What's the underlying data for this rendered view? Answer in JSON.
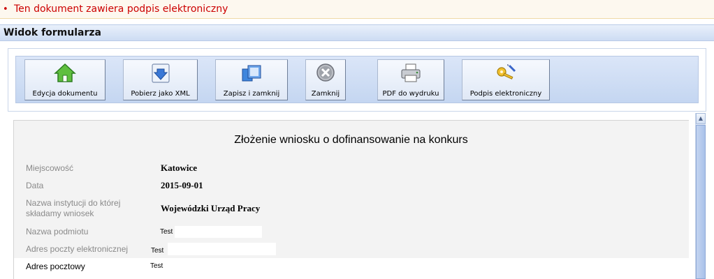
{
  "notice": {
    "bullet": "•",
    "text": "Ten dokument zawiera podpis elektroniczny",
    "color": "#cc0000"
  },
  "header": {
    "title": "Widok formularza"
  },
  "toolbar": {
    "buttons": [
      {
        "label": "Edycja dokumentu",
        "icon": "home-icon"
      },
      {
        "label": "Pobierz jako XML",
        "icon": "download-icon"
      },
      {
        "label": "Zapisz i zamknij",
        "icon": "save-close-icon"
      },
      {
        "label": "Zamknij",
        "icon": "close-icon"
      },
      {
        "label": "PDF do wydruku",
        "icon": "printer-icon"
      },
      {
        "label": "Podpis elektroniczny",
        "icon": "key-pen-icon"
      }
    ]
  },
  "form": {
    "title": "Złożenie wniosku o dofinansowanie na konkurs",
    "fields": [
      {
        "label": "Miejscowość",
        "value": "Katowice"
      },
      {
        "label": "Data",
        "value": "2015-09-01"
      },
      {
        "label_line1": "Nazwa instytucji do której",
        "label_line2": "składamy wniosek",
        "value": "Wojewódzki Urząd Pracy"
      },
      {
        "label": "Nazwa podmiotu",
        "value": "Test"
      },
      {
        "label": "Adres poczty elektronicznej",
        "value": "Test"
      },
      {
        "label": "Adres pocztowy",
        "value": "Test"
      }
    ]
  }
}
